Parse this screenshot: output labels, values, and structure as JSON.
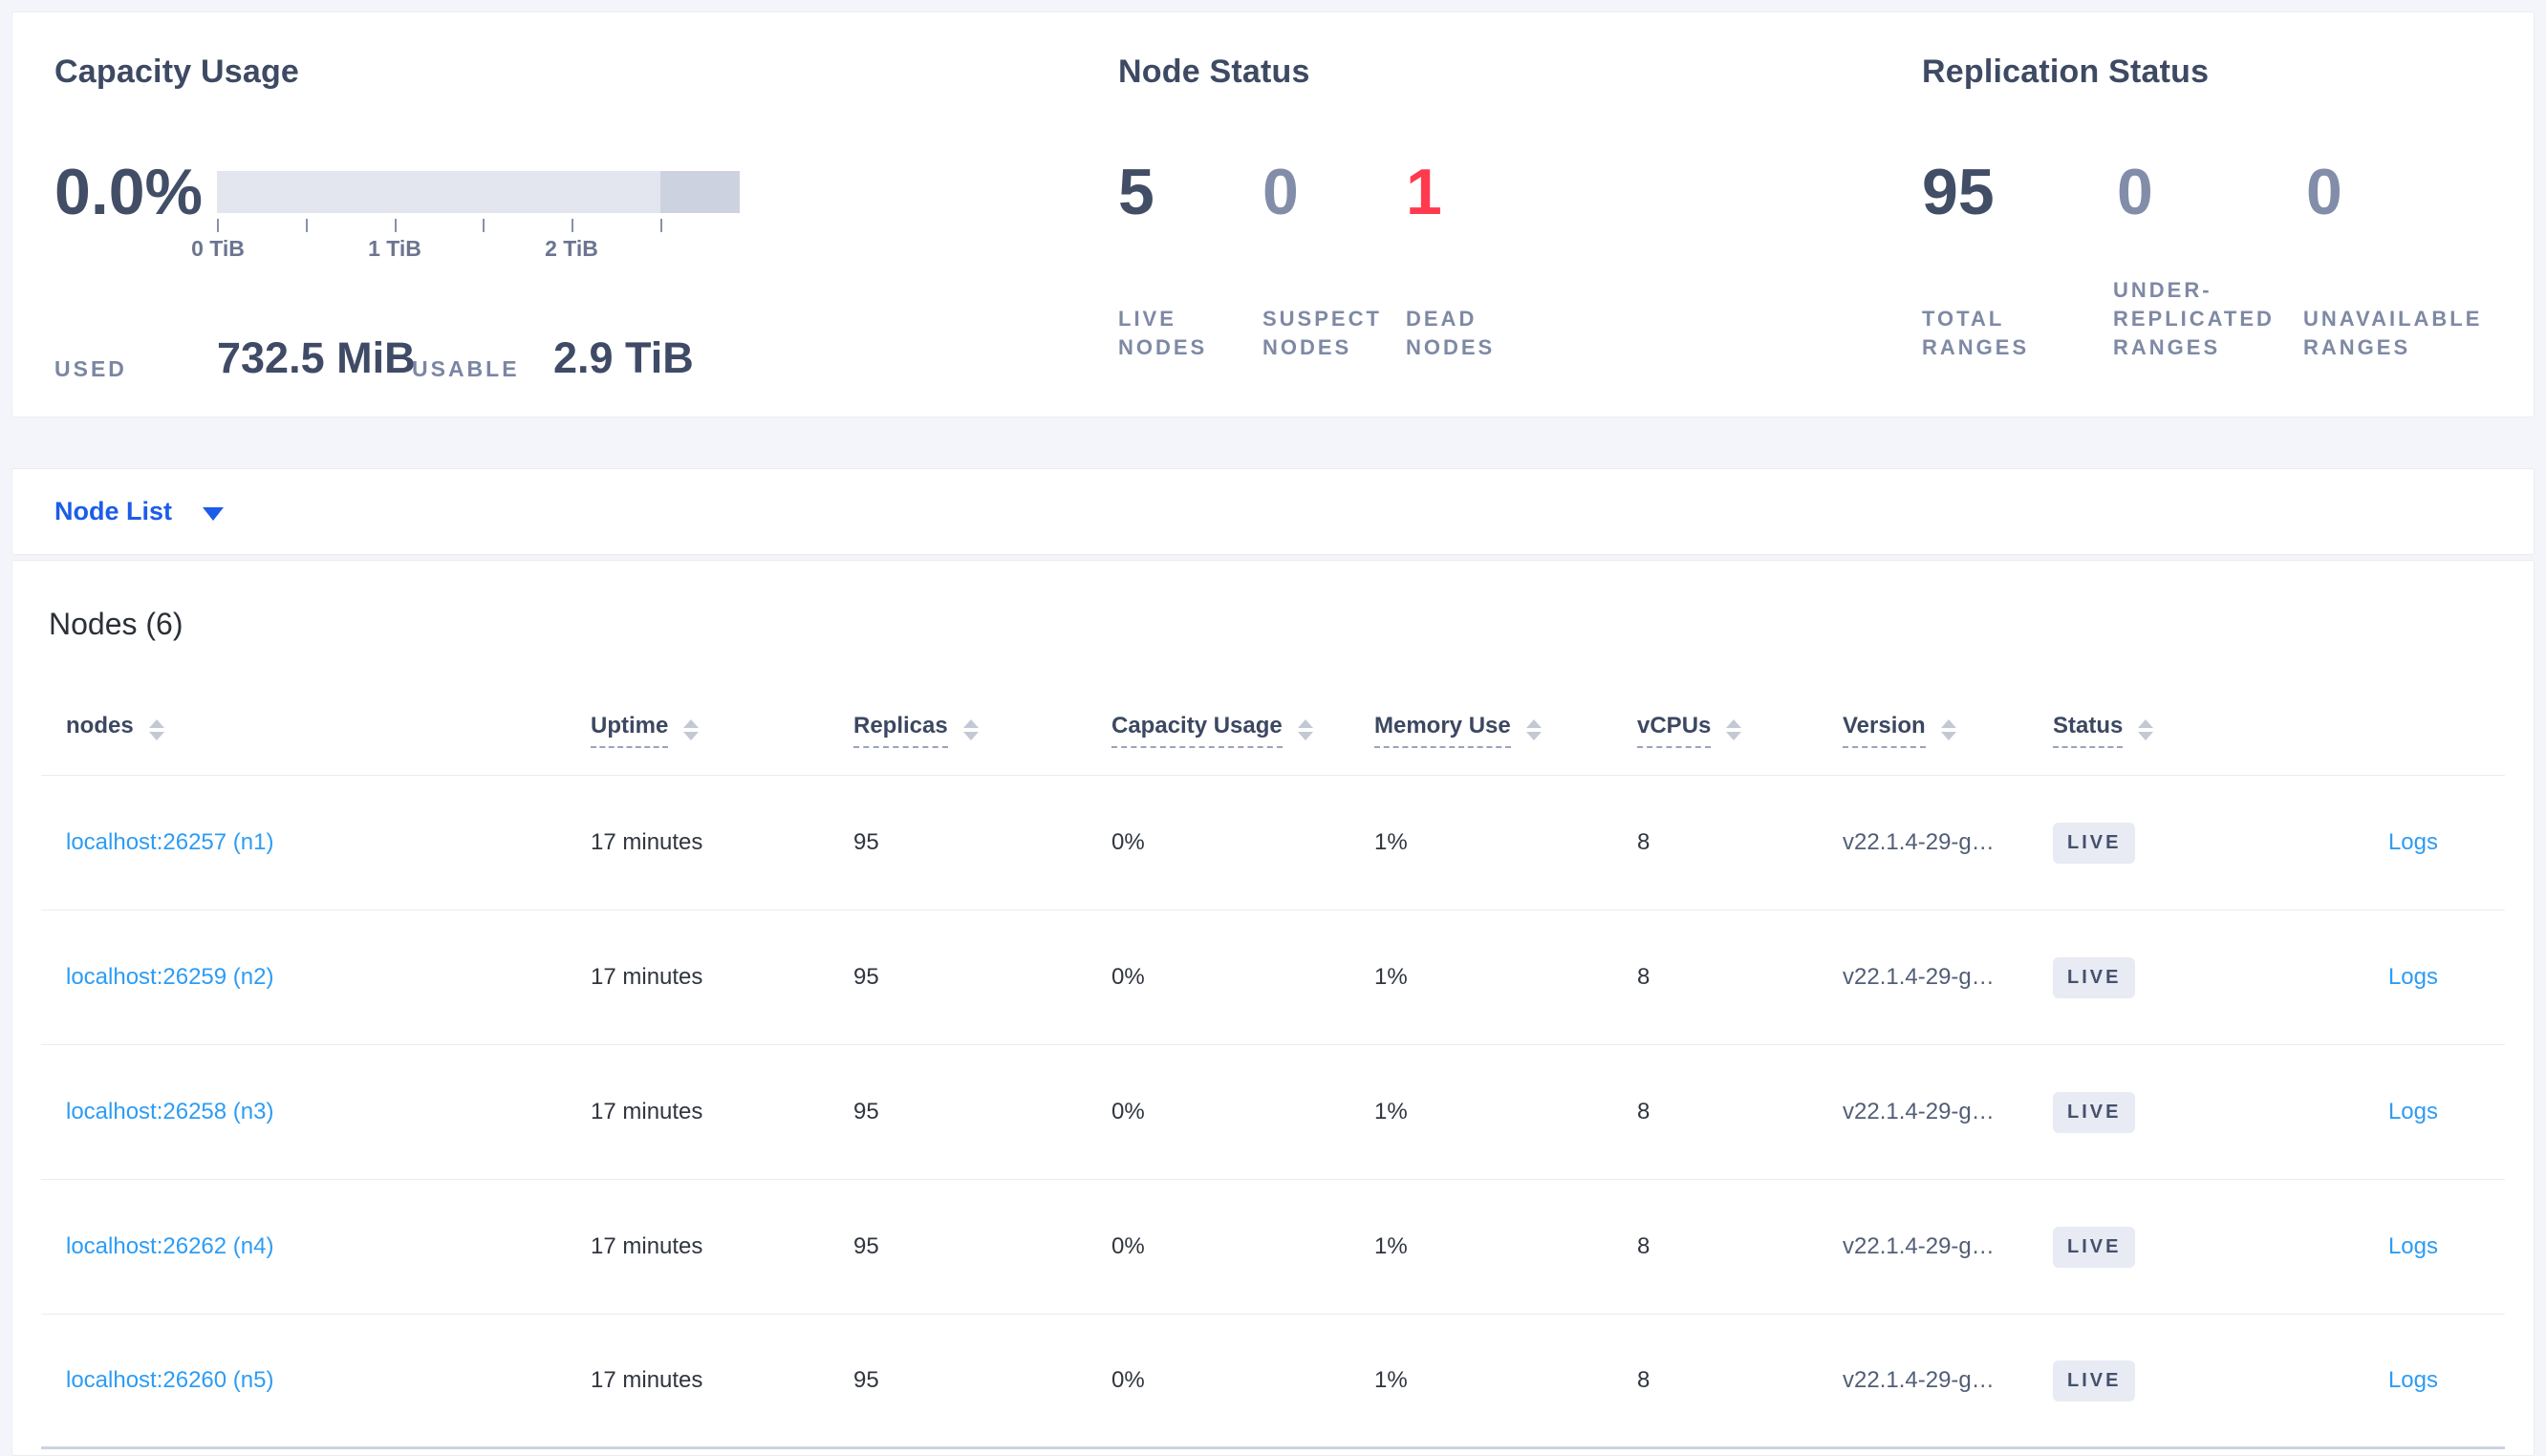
{
  "colors": {
    "accent_blue": "#1c5ce8",
    "link_blue": "#2d9cf4",
    "dead_red": "#ff3a4f",
    "dark_number": "#414e66",
    "muted_number": "#828da9",
    "badge_bg": "#e8ebf3",
    "page_bg": "#f4f5fa"
  },
  "capacity_usage": {
    "title": "Capacity Usage",
    "percent": "0.0%",
    "tick_labels": [
      "0 TiB",
      "1 TiB",
      "2 TiB"
    ],
    "used_label": "USED",
    "used_value": "732.5 MiB",
    "usable_label": "USABLE",
    "usable_value": "2.9 TiB"
  },
  "node_status": {
    "title": "Node Status",
    "stats": [
      {
        "value": "5",
        "label": "LIVE NODES",
        "state": "live"
      },
      {
        "value": "0",
        "label": "SUSPECT NODES",
        "state": "suspect"
      },
      {
        "value": "1",
        "label": "DEAD NODES",
        "state": "dead"
      }
    ]
  },
  "replication_status": {
    "title": "Replication Status",
    "stats": [
      {
        "value": "95",
        "label": "TOTAL RANGES",
        "state": "total"
      },
      {
        "value": "0",
        "label": "UNDER-REPLICATED RANGES",
        "state": "muted"
      },
      {
        "value": "0",
        "label": "UNAVAILABLE RANGES",
        "state": "muted"
      }
    ]
  },
  "view_selector": {
    "label": "Node List"
  },
  "nodes_table": {
    "title": "Nodes (6)",
    "columns": [
      {
        "key": "node",
        "label": "nodes",
        "tooltip": false
      },
      {
        "key": "uptime",
        "label": "Uptime",
        "tooltip": true
      },
      {
        "key": "replicas",
        "label": "Replicas",
        "tooltip": true
      },
      {
        "key": "capacity",
        "label": "Capacity Usage",
        "tooltip": true
      },
      {
        "key": "memory",
        "label": "Memory Use",
        "tooltip": true
      },
      {
        "key": "vcpus",
        "label": "vCPUs",
        "tooltip": true
      },
      {
        "key": "version",
        "label": "Version",
        "tooltip": true
      },
      {
        "key": "status",
        "label": "Status",
        "tooltip": true
      },
      {
        "key": "logs",
        "label": "",
        "tooltip": false
      }
    ],
    "rows": [
      {
        "node": "localhost:26257 (n1)",
        "uptime": "17 minutes",
        "replicas": "95",
        "capacity": "0%",
        "memory": "1%",
        "vcpus": "8",
        "version": "v22.1.4-29-g…",
        "status": "LIVE",
        "logs": "Logs"
      },
      {
        "node": "localhost:26259 (n2)",
        "uptime": "17 minutes",
        "replicas": "95",
        "capacity": "0%",
        "memory": "1%",
        "vcpus": "8",
        "version": "v22.1.4-29-g…",
        "status": "LIVE",
        "logs": "Logs"
      },
      {
        "node": "localhost:26258 (n3)",
        "uptime": "17 minutes",
        "replicas": "95",
        "capacity": "0%",
        "memory": "1%",
        "vcpus": "8",
        "version": "v22.1.4-29-g…",
        "status": "LIVE",
        "logs": "Logs"
      },
      {
        "node": "localhost:26262 (n4)",
        "uptime": "17 minutes",
        "replicas": "95",
        "capacity": "0%",
        "memory": "1%",
        "vcpus": "8",
        "version": "v22.1.4-29-g…",
        "status": "LIVE",
        "logs": "Logs"
      },
      {
        "node": "localhost:26260 (n5)",
        "uptime": "17 minutes",
        "replicas": "95",
        "capacity": "0%",
        "memory": "1%",
        "vcpus": "8",
        "version": "v22.1.4-29-g…",
        "status": "LIVE",
        "logs": "Logs"
      }
    ]
  }
}
